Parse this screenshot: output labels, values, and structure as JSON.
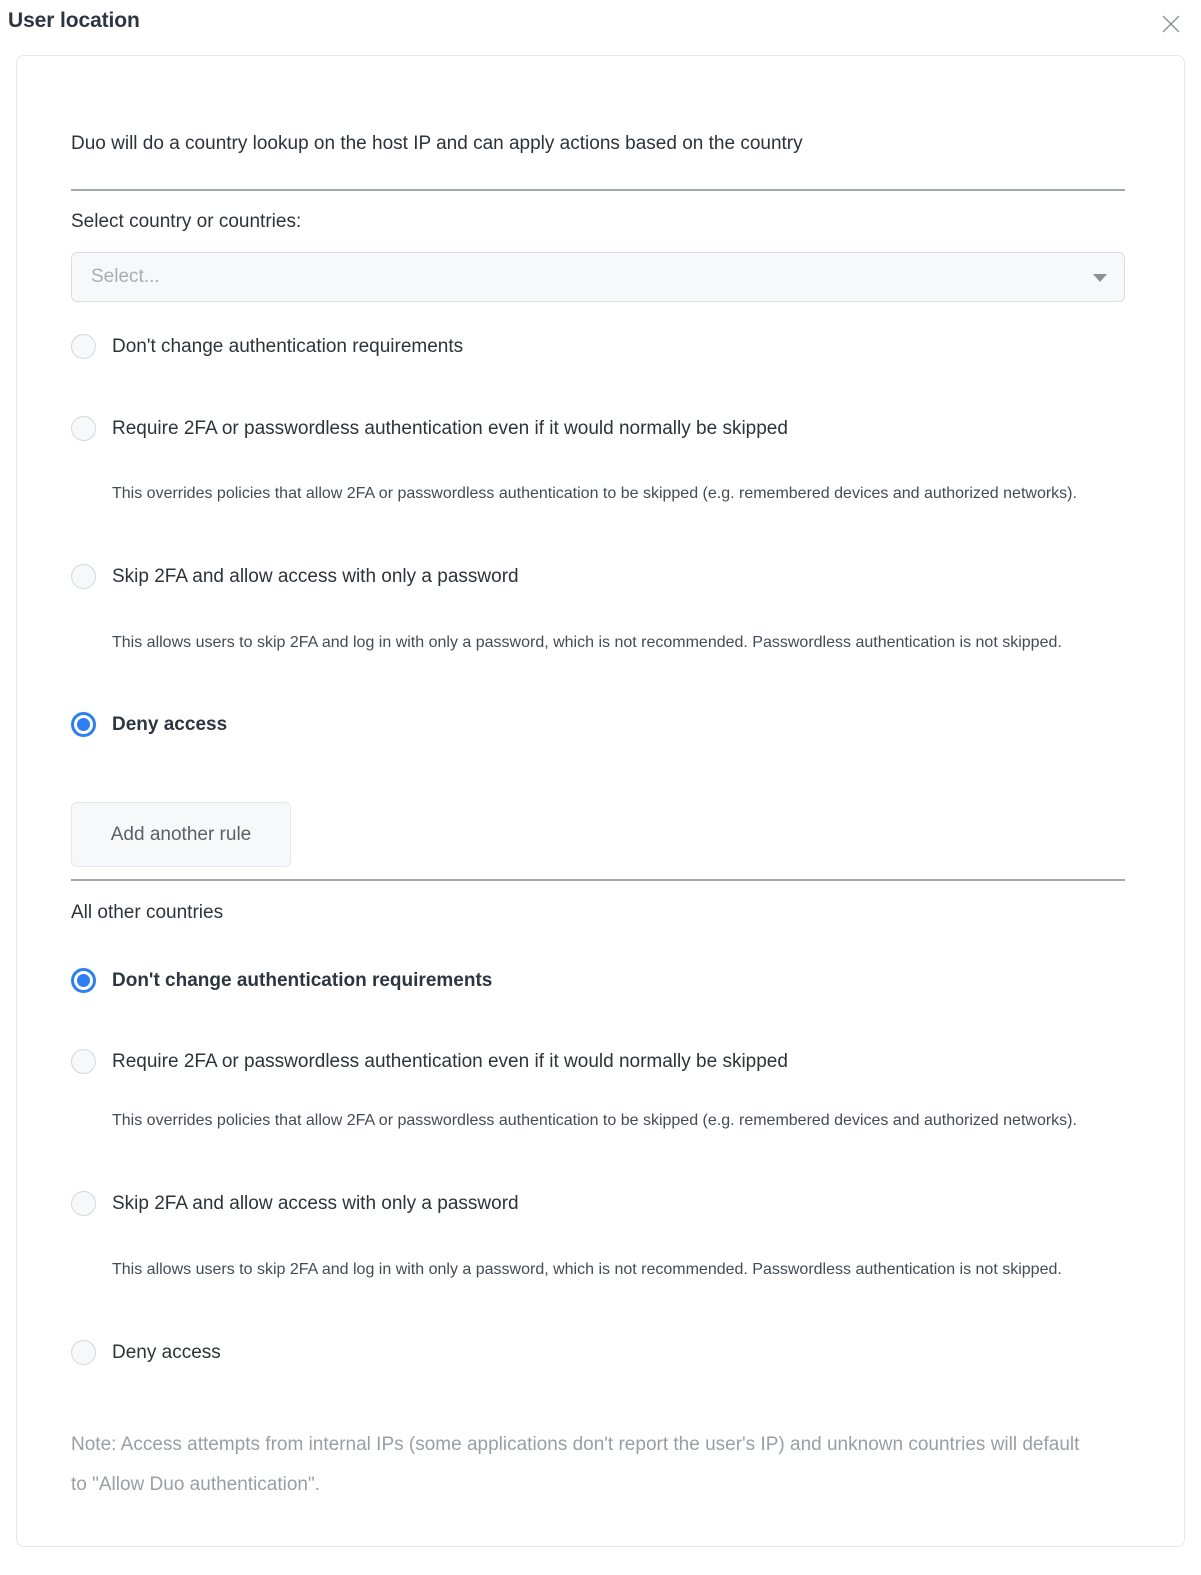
{
  "header": {
    "title": "User location",
    "close_icon": "close-icon"
  },
  "card": {
    "intro": "Duo will do a country lookup on the host IP and can apply actions based on the country",
    "country_field": {
      "label": "Select country or countries:",
      "placeholder": "Select...",
      "value": "",
      "caret_icon": "chevron-down-icon"
    },
    "rule_group": {
      "options": [
        {
          "label": "Don't change authentication requirements",
          "selected": false,
          "help": ""
        },
        {
          "label": "Require 2FA or passwordless authentication even if it would normally be skipped",
          "selected": false,
          "help": "This overrides policies that allow 2FA or passwordless authentication to be skipped (e.g. remembered devices and authorized networks)."
        },
        {
          "label": "Skip 2FA and allow access with only a password",
          "selected": false,
          "help": "This allows users to skip 2FA and log in with only a password, which is not recommended. Passwordless authentication is not skipped."
        },
        {
          "label": "Deny access",
          "selected": true,
          "help": ""
        }
      ],
      "add_rule_label": "Add another rule"
    },
    "all_other_countries": {
      "heading": "All other countries",
      "options": [
        {
          "label": "Don't change authentication requirements",
          "selected": true,
          "help": ""
        },
        {
          "label": "Require 2FA or passwordless authentication even if it would normally be skipped",
          "selected": false,
          "help": "This overrides policies that allow 2FA or passwordless authentication to be skipped (e.g. remembered devices and authorized networks)."
        },
        {
          "label": "Skip 2FA and allow access with only a password",
          "selected": false,
          "help": "This allows users to skip 2FA and log in with only a password, which is not recommended. Passwordless authentication is not skipped."
        },
        {
          "label": "Deny access",
          "selected": false,
          "help": ""
        }
      ]
    },
    "note": "Note: Access attempts from internal IPs (some applications don't report the user's IP) and unknown countries will default to \"Allow Duo authentication\"."
  },
  "colors": {
    "accent": "#2d7ff0",
    "title": "#2d3640",
    "body": "#2e3338",
    "muted": "#9a9ea3",
    "card_border": "#e3e8ef",
    "divider": "#a3a8ad"
  }
}
